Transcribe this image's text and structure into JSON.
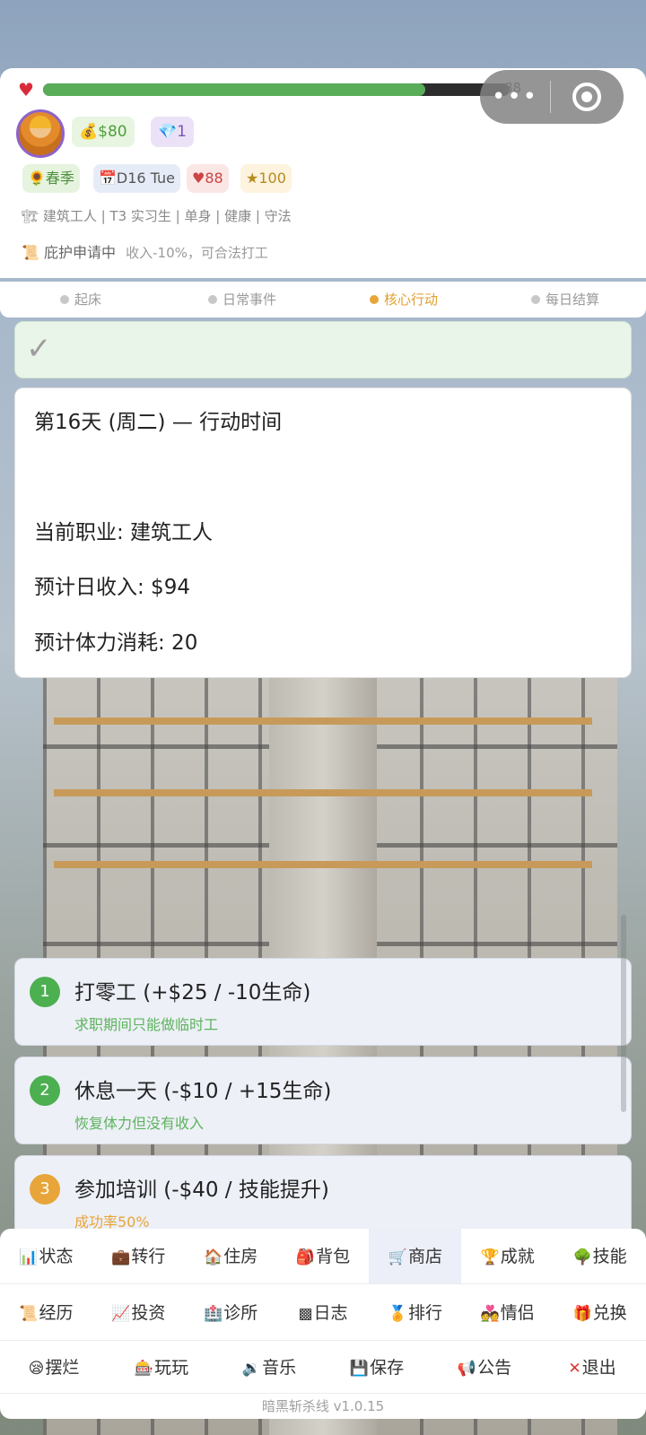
{
  "status": {
    "hp_value": "88",
    "hp_fraction": 0.82,
    "money": "$80",
    "gems": "1",
    "tags": {
      "season": "春季",
      "day": "D16 Tue",
      "hp": "88",
      "star": "100"
    },
    "info_line": "建筑工人 | T3 实习生 | 单身 | 健康 | 守法",
    "asylum_title": "庇护申请中",
    "asylum_note": "收入-10%，可合法打工"
  },
  "capsule": {
    "more_label": "•••"
  },
  "phases": [
    {
      "label": "起床",
      "active": false
    },
    {
      "label": "日常事件",
      "active": false
    },
    {
      "label": "核心行动",
      "active": true
    },
    {
      "label": "每日结算",
      "active": false
    }
  ],
  "main": {
    "heading": "第16天 (周二) — 行动时间",
    "job": "当前职业: 建筑工人",
    "income": "预计日收入: $94",
    "stamina": "预计体力消耗: 20"
  },
  "options": [
    {
      "num": "1",
      "title": "打零工 (+$25 / -10生命)",
      "subtitle": "求职期间只能做临时工",
      "num_color": "#4caf50",
      "sub_color": "#5db35d"
    },
    {
      "num": "2",
      "title": "休息一天 (-$10 / +15生命)",
      "subtitle": "恢复体力但没有收入",
      "num_color": "#4caf50",
      "sub_color": "#5db35d"
    },
    {
      "num": "3",
      "title": "参加培训 (-$40 / 技能提升)",
      "subtitle": "成功率50%",
      "num_color": "#e8a53a",
      "sub_color": "#e8a53a"
    }
  ],
  "nav": {
    "row1": [
      {
        "label": "状态",
        "icon": "chart-icon"
      },
      {
        "label": "转行",
        "icon": "briefcase-icon"
      },
      {
        "label": "住房",
        "icon": "house-icon"
      },
      {
        "label": "背包",
        "icon": "backpack-icon"
      },
      {
        "label": "商店",
        "icon": "cart-icon",
        "active": true
      },
      {
        "label": "成就",
        "icon": "trophy-icon"
      },
      {
        "label": "技能",
        "icon": "tree-icon"
      }
    ],
    "row2": [
      {
        "label": "经历",
        "icon": "scroll-icon"
      },
      {
        "label": "投资",
        "icon": "trend-icon"
      },
      {
        "label": "诊所",
        "icon": "hospital-icon"
      },
      {
        "label": "日志",
        "icon": "log-icon"
      },
      {
        "label": "排行",
        "icon": "medal-icon"
      },
      {
        "label": "情侣",
        "icon": "couple-icon"
      },
      {
        "label": "兑换",
        "icon": "gift-icon"
      }
    ],
    "row3": [
      {
        "label": "摆烂",
        "icon": "sleepy-icon"
      },
      {
        "label": "玩玩",
        "icon": "slot-icon"
      },
      {
        "label": "音乐",
        "icon": "speaker-icon"
      },
      {
        "label": "保存",
        "icon": "floppy-icon"
      },
      {
        "label": "公告",
        "icon": "megaphone-icon"
      },
      {
        "label": "退出",
        "icon": "x-icon"
      }
    ]
  },
  "version": "暗黑斩杀线 v1.0.15"
}
